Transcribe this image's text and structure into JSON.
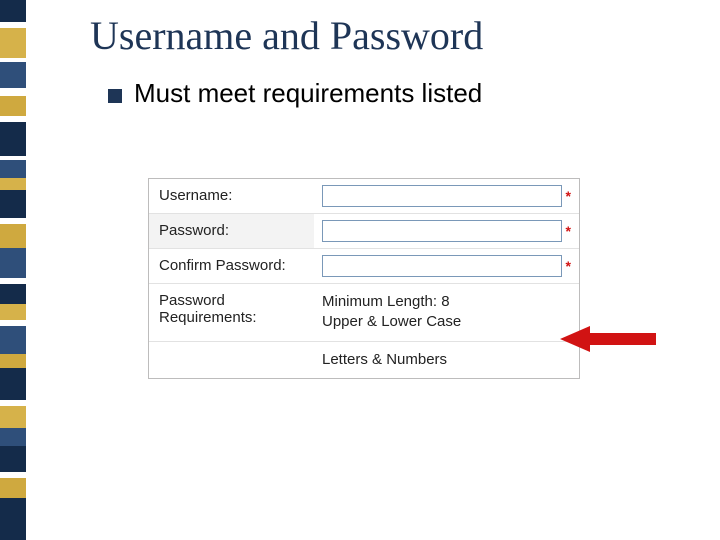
{
  "title": "Username and Password",
  "bullet": "Must meet requirements listed",
  "labels": {
    "username": "Username:",
    "password": "Password:",
    "confirm": "Confirm Password:",
    "reqs": "Password Requirements:"
  },
  "values": {
    "username": "",
    "password": "",
    "confirm": ""
  },
  "asterisk": "*",
  "req_lines": {
    "l1": "Minimum Length: 8",
    "l2": "Upper & Lower Case",
    "l3": "Letters & Numbers"
  },
  "stripe_colors": [
    {
      "c": "#142b4a",
      "h": 22
    },
    {
      "c": "#ffffff",
      "h": 6
    },
    {
      "c": "#d6b24a",
      "h": 30
    },
    {
      "c": "#ffffff",
      "h": 4
    },
    {
      "c": "#2f4f7a",
      "h": 26
    },
    {
      "c": "#ffffff",
      "h": 8
    },
    {
      "c": "#cfa93f",
      "h": 20
    },
    {
      "c": "#ffffff",
      "h": 6
    },
    {
      "c": "#142b4a",
      "h": 34
    },
    {
      "c": "#ffffff",
      "h": 4
    },
    {
      "c": "#2f4f7a",
      "h": 18
    },
    {
      "c": "#d6b24a",
      "h": 12
    },
    {
      "c": "#142b4a",
      "h": 28
    },
    {
      "c": "#ffffff",
      "h": 6
    },
    {
      "c": "#cfa93f",
      "h": 24
    },
    {
      "c": "#2f4f7a",
      "h": 30
    },
    {
      "c": "#ffffff",
      "h": 6
    },
    {
      "c": "#142b4a",
      "h": 20
    },
    {
      "c": "#d6b24a",
      "h": 16
    },
    {
      "c": "#ffffff",
      "h": 6
    },
    {
      "c": "#2f4f7a",
      "h": 28
    },
    {
      "c": "#cfa93f",
      "h": 14
    },
    {
      "c": "#142b4a",
      "h": 32
    },
    {
      "c": "#ffffff",
      "h": 6
    },
    {
      "c": "#d6b24a",
      "h": 22
    },
    {
      "c": "#2f4f7a",
      "h": 18
    },
    {
      "c": "#142b4a",
      "h": 26
    },
    {
      "c": "#ffffff",
      "h": 6
    },
    {
      "c": "#cfa93f",
      "h": 20
    },
    {
      "c": "#142b4a",
      "h": 42
    }
  ]
}
